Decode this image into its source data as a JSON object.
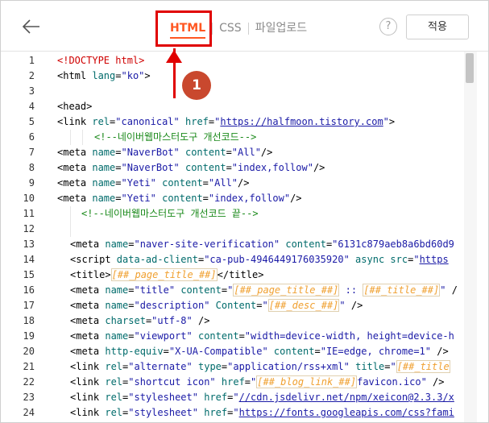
{
  "header": {
    "tabs": [
      {
        "label": "HTML"
      },
      {
        "label": "CSS"
      },
      {
        "label": "파일업로드"
      }
    ],
    "help_label": "?",
    "apply_label": "적용"
  },
  "callout": {
    "number": "1"
  },
  "code_lines": [
    {
      "n": "1",
      "segs": [
        [
          "d",
          "<!DOCTYPE html>"
        ]
      ]
    },
    {
      "n": "2",
      "segs": [
        [
          "t",
          "<html "
        ],
        [
          "a",
          "lang"
        ],
        [
          "t",
          "="
        ],
        [
          "v",
          "\"ko\""
        ],
        [
          "t",
          ">"
        ]
      ]
    },
    {
      "n": "3",
      "segs": []
    },
    {
      "n": "4",
      "segs": [
        [
          "t",
          "<head>"
        ]
      ]
    },
    {
      "n": "5",
      "segs": [
        [
          "t",
          "<link "
        ],
        [
          "a",
          "rel"
        ],
        [
          "t",
          "="
        ],
        [
          "v",
          "\"canonical\""
        ],
        [
          "t",
          " "
        ],
        [
          "a",
          "href"
        ],
        [
          "t",
          "="
        ],
        [
          "v",
          "\""
        ],
        [
          "u",
          "https://halfmoon.tistory.com"
        ],
        [
          "v",
          "\""
        ],
        [
          "t",
          ">"
        ]
      ]
    },
    {
      "n": "6",
      "segs": [
        [
          "c",
          "<!--네이버웹마스터도구 개선코드-->"
        ]
      ]
    },
    {
      "n": "7",
      "segs": [
        [
          "t",
          "<meta "
        ],
        [
          "a",
          "name"
        ],
        [
          "t",
          "="
        ],
        [
          "v",
          "\"NaverBot\""
        ],
        [
          "t",
          " "
        ],
        [
          "a",
          "content"
        ],
        [
          "t",
          "="
        ],
        [
          "v",
          "\"All\""
        ],
        [
          "t",
          "/>"
        ]
      ]
    },
    {
      "n": "8",
      "segs": [
        [
          "t",
          "<meta "
        ],
        [
          "a",
          "name"
        ],
        [
          "t",
          "="
        ],
        [
          "v",
          "\"NaverBot\""
        ],
        [
          "t",
          " "
        ],
        [
          "a",
          "content"
        ],
        [
          "t",
          "="
        ],
        [
          "v",
          "\"index,follow\""
        ],
        [
          "t",
          "/>"
        ]
      ]
    },
    {
      "n": "9",
      "segs": [
        [
          "t",
          "<meta "
        ],
        [
          "a",
          "name"
        ],
        [
          "t",
          "="
        ],
        [
          "v",
          "\"Yeti\""
        ],
        [
          "t",
          " "
        ],
        [
          "a",
          "content"
        ],
        [
          "t",
          "="
        ],
        [
          "v",
          "\"All\""
        ],
        [
          "t",
          "/>"
        ]
      ]
    },
    {
      "n": "10",
      "segs": [
        [
          "t",
          "<meta "
        ],
        [
          "a",
          "name"
        ],
        [
          "t",
          "="
        ],
        [
          "v",
          "\"Yeti\""
        ],
        [
          "t",
          " "
        ],
        [
          "a",
          "content"
        ],
        [
          "t",
          "="
        ],
        [
          "v",
          "\"index,follow\""
        ],
        [
          "t",
          "/>"
        ]
      ]
    },
    {
      "n": "11",
      "segs": [
        [
          "c",
          "<!--네이버웹마스터도구 개선코드 끝-->"
        ]
      ]
    },
    {
      "n": "12",
      "segs": []
    },
    {
      "n": "13",
      "segs": [
        [
          "t",
          "<meta "
        ],
        [
          "a",
          "name"
        ],
        [
          "t",
          "="
        ],
        [
          "v",
          "\"naver-site-verification\""
        ],
        [
          "t",
          " "
        ],
        [
          "a",
          "content"
        ],
        [
          "t",
          "="
        ],
        [
          "v",
          "\"6131c879aeb8a6bd60d9"
        ]
      ]
    },
    {
      "n": "14",
      "segs": [
        [
          "t",
          "<script "
        ],
        [
          "a",
          "data-ad-client"
        ],
        [
          "t",
          "="
        ],
        [
          "v",
          "\"ca-pub-4946449176035920\""
        ],
        [
          "t",
          " "
        ],
        [
          "a",
          "async"
        ],
        [
          "t",
          " "
        ],
        [
          "a",
          "src"
        ],
        [
          "t",
          "="
        ],
        [
          "v",
          "\""
        ],
        [
          "u",
          "https"
        ]
      ]
    },
    {
      "n": "15",
      "segs": [
        [
          "t",
          "<title>"
        ],
        [
          "tmbox",
          "[##_page_title_##]"
        ],
        [
          "t",
          "</title>"
        ]
      ]
    },
    {
      "n": "16",
      "segs": [
        [
          "t",
          "<meta "
        ],
        [
          "a",
          "name"
        ],
        [
          "t",
          "="
        ],
        [
          "v",
          "\"title\""
        ],
        [
          "t",
          " "
        ],
        [
          "a",
          "content"
        ],
        [
          "t",
          "="
        ],
        [
          "v",
          "\""
        ],
        [
          "tmbox",
          "[##_page_title_##]"
        ],
        [
          "v",
          " :: "
        ],
        [
          "tmbox",
          "[##_title_##]"
        ],
        [
          "v",
          "\""
        ],
        [
          "t",
          " /"
        ]
      ]
    },
    {
      "n": "17",
      "segs": [
        [
          "t",
          "<meta "
        ],
        [
          "a",
          "name"
        ],
        [
          "t",
          "="
        ],
        [
          "v",
          "\"description\""
        ],
        [
          "t",
          " "
        ],
        [
          "a",
          "Content"
        ],
        [
          "t",
          "="
        ],
        [
          "v",
          "\""
        ],
        [
          "tmbox",
          "[##_desc_##]"
        ],
        [
          "v",
          "\""
        ],
        [
          "t",
          " />"
        ]
      ]
    },
    {
      "n": "18",
      "segs": [
        [
          "t",
          "<meta "
        ],
        [
          "a",
          "charset"
        ],
        [
          "t",
          "="
        ],
        [
          "v",
          "\"utf-8\""
        ],
        [
          "t",
          " />"
        ]
      ]
    },
    {
      "n": "19",
      "segs": [
        [
          "t",
          "<meta "
        ],
        [
          "a",
          "name"
        ],
        [
          "t",
          "="
        ],
        [
          "v",
          "\"viewport\""
        ],
        [
          "t",
          " "
        ],
        [
          "a",
          "content"
        ],
        [
          "t",
          "="
        ],
        [
          "v",
          "\"width=device-width, height=device-h"
        ]
      ]
    },
    {
      "n": "20",
      "segs": [
        [
          "t",
          "<meta "
        ],
        [
          "a",
          "http-equiv"
        ],
        [
          "t",
          "="
        ],
        [
          "v",
          "\"X-UA-Compatible\""
        ],
        [
          "t",
          " "
        ],
        [
          "a",
          "content"
        ],
        [
          "t",
          "="
        ],
        [
          "v",
          "\"IE=edge, chrome=1\""
        ],
        [
          "t",
          " />"
        ]
      ]
    },
    {
      "n": "21",
      "segs": [
        [
          "t",
          "<link "
        ],
        [
          "a",
          "rel"
        ],
        [
          "t",
          "="
        ],
        [
          "v",
          "\"alternate\""
        ],
        [
          "t",
          " "
        ],
        [
          "a",
          "type"
        ],
        [
          "t",
          "="
        ],
        [
          "v",
          "\"application/rss+xml\""
        ],
        [
          "t",
          " "
        ],
        [
          "a",
          "title"
        ],
        [
          "t",
          "="
        ],
        [
          "v",
          "\""
        ],
        [
          "tmbox",
          "[##_title"
        ]
      ]
    },
    {
      "n": "22",
      "segs": [
        [
          "t",
          "<link "
        ],
        [
          "a",
          "rel"
        ],
        [
          "t",
          "="
        ],
        [
          "v",
          "\"shortcut icon\""
        ],
        [
          "t",
          " "
        ],
        [
          "a",
          "href"
        ],
        [
          "t",
          "="
        ],
        [
          "v",
          "\""
        ],
        [
          "tmbox",
          "[##_blog_link_##]"
        ],
        [
          "v",
          "favicon.ico\""
        ],
        [
          "t",
          " />"
        ]
      ]
    },
    {
      "n": "23",
      "segs": [
        [
          "t",
          "<link "
        ],
        [
          "a",
          "rel"
        ],
        [
          "t",
          "="
        ],
        [
          "v",
          "\"stylesheet\""
        ],
        [
          "t",
          " "
        ],
        [
          "a",
          "href"
        ],
        [
          "t",
          "="
        ],
        [
          "v",
          "\""
        ],
        [
          "u",
          "//cdn.jsdelivr.net/npm/xeicon@2.3.3/x"
        ]
      ]
    },
    {
      "n": "24",
      "segs": [
        [
          "t",
          "<link "
        ],
        [
          "a",
          "rel"
        ],
        [
          "t",
          "="
        ],
        [
          "v",
          "\"stylesheet\""
        ],
        [
          "t",
          " "
        ],
        [
          "a",
          "href"
        ],
        [
          "t",
          "="
        ],
        [
          "v",
          "\""
        ],
        [
          "u",
          "https://fonts.googleapis.com/css?fami"
        ]
      ]
    }
  ]
}
